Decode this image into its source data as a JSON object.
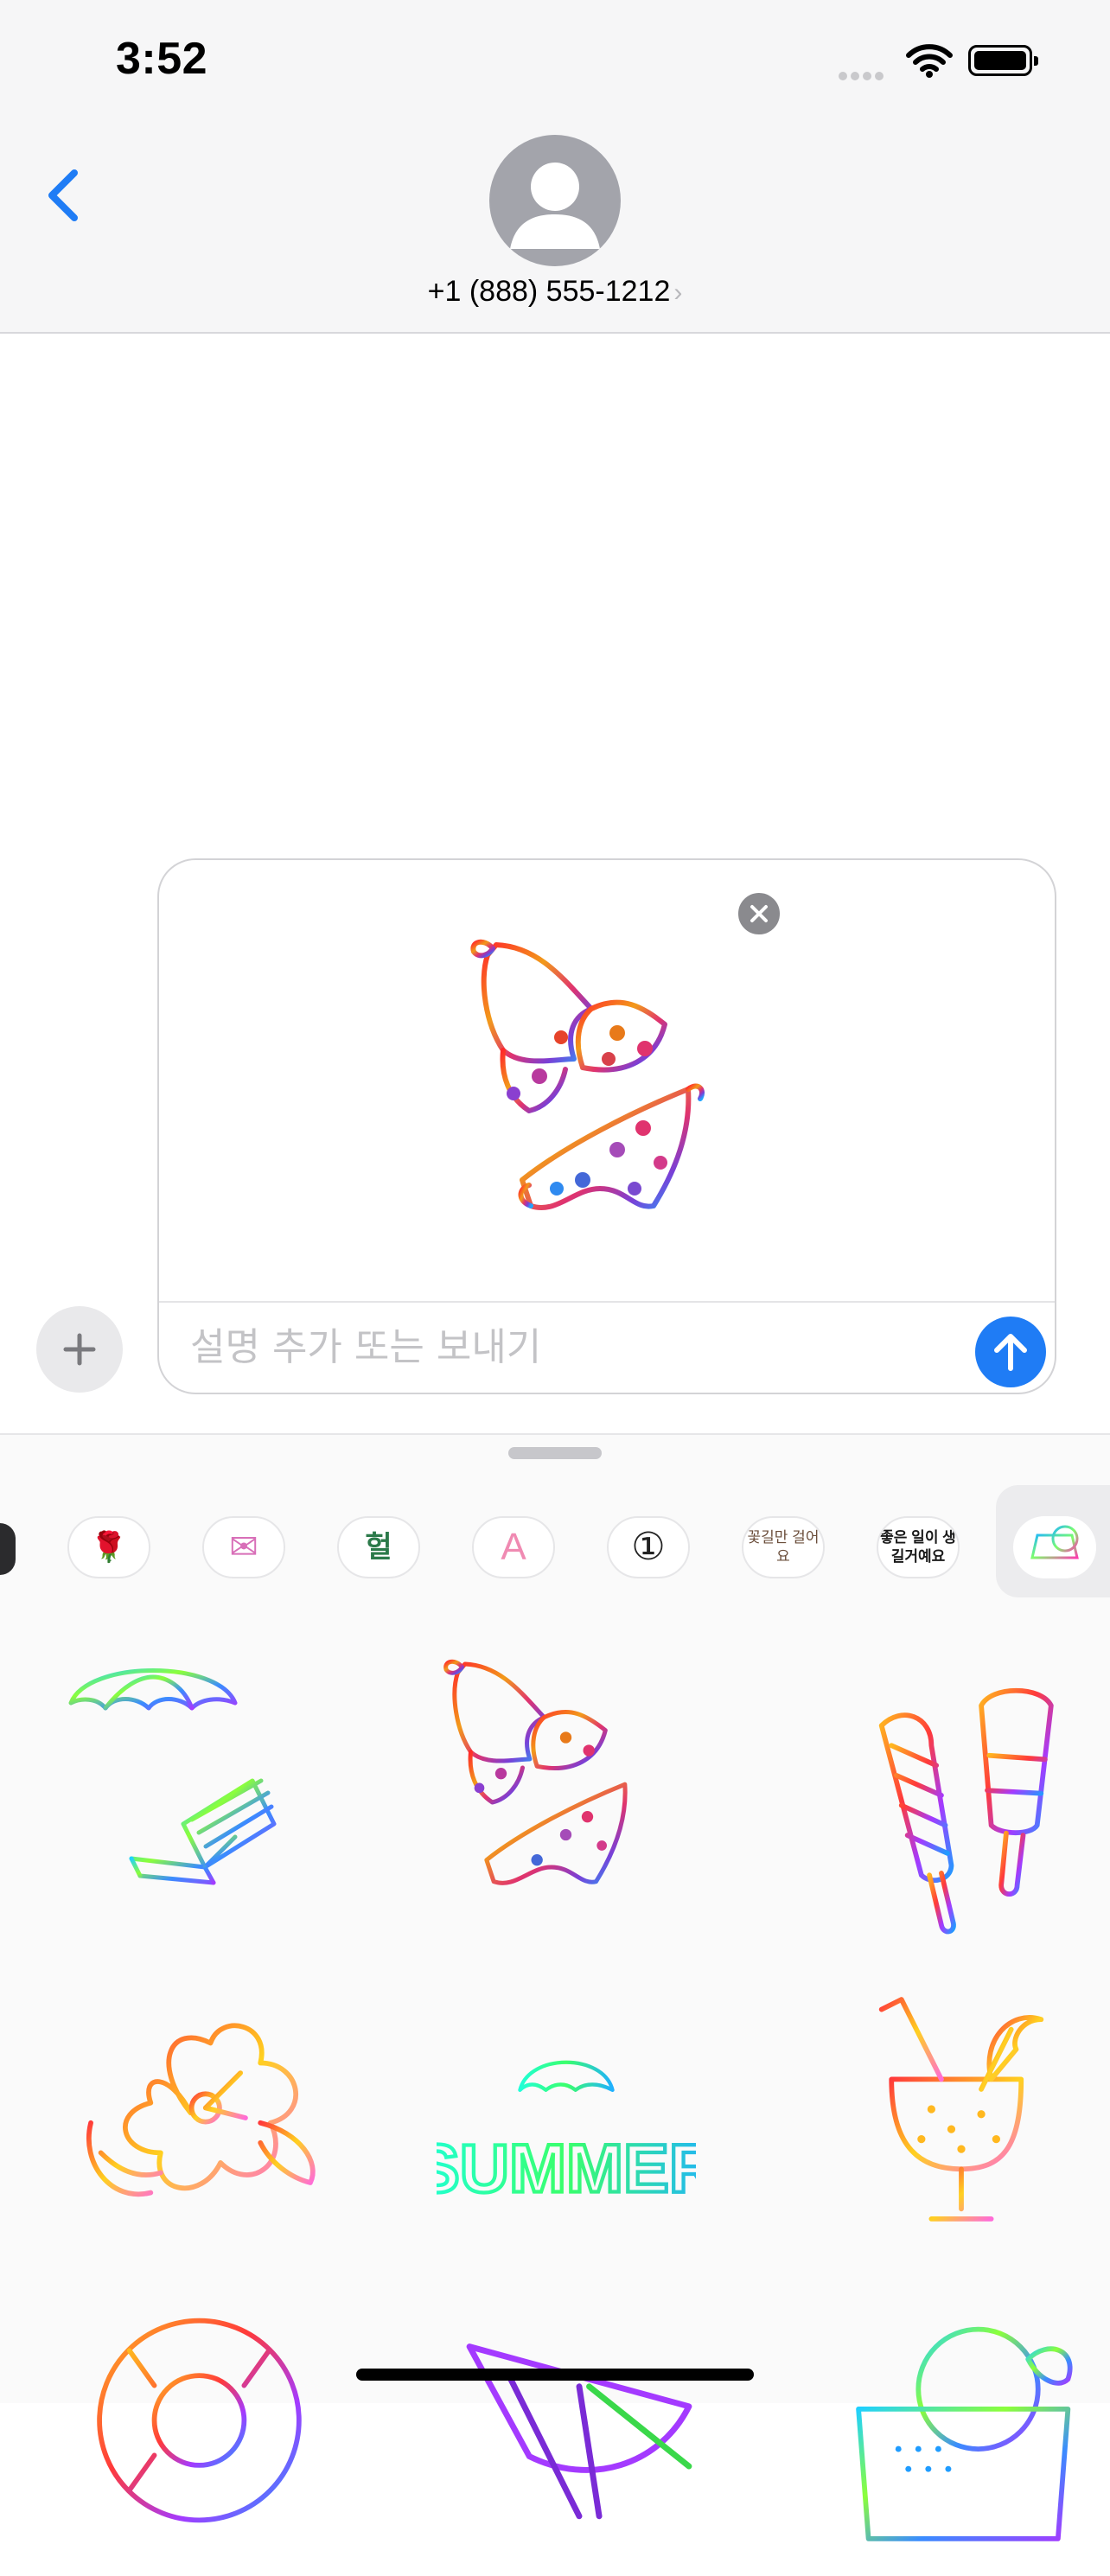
{
  "status": {
    "time": "3:52"
  },
  "nav": {
    "phone": "+1 (888) 555-1212",
    "chevron": "›"
  },
  "compose": {
    "placeholder": "설명 추가 또는 보내기",
    "preview_sticker": "bikini-sticker"
  },
  "tray": {
    "items": [
      {
        "icon": "rose-sticker-icon",
        "text": "🌹"
      },
      {
        "icon": "love-letter-sticker-icon",
        "text": "✉"
      },
      {
        "icon": "korean-text-sticker-icon",
        "text": "헐"
      },
      {
        "icon": "letter-a-sticker-icon",
        "text": "A"
      },
      {
        "icon": "circled-one-sticker-icon",
        "text": "①"
      },
      {
        "icon": "korean-phrase-sticker-icon",
        "text": "꽃길만 걸어요"
      },
      {
        "icon": "korean-phrase-sticker-icon-2",
        "text": "좋은 일이 생길거예요"
      }
    ],
    "selected": "summer-pack-icon"
  },
  "stickers": [
    "beach-chair-umbrella-sticker",
    "bikini-sticker",
    "popsicles-sticker",
    "hibiscus-flower-sticker",
    {
      "name": "summer-text-sticker",
      "text": "SUMMER"
    },
    "tropical-drink-sticker",
    "swim-ring-sticker",
    "watermelon-sticker",
    "beach-bag-sticker"
  ],
  "colors": {
    "accent": "#1f7cf5",
    "chrome": "#f6f6f7"
  }
}
